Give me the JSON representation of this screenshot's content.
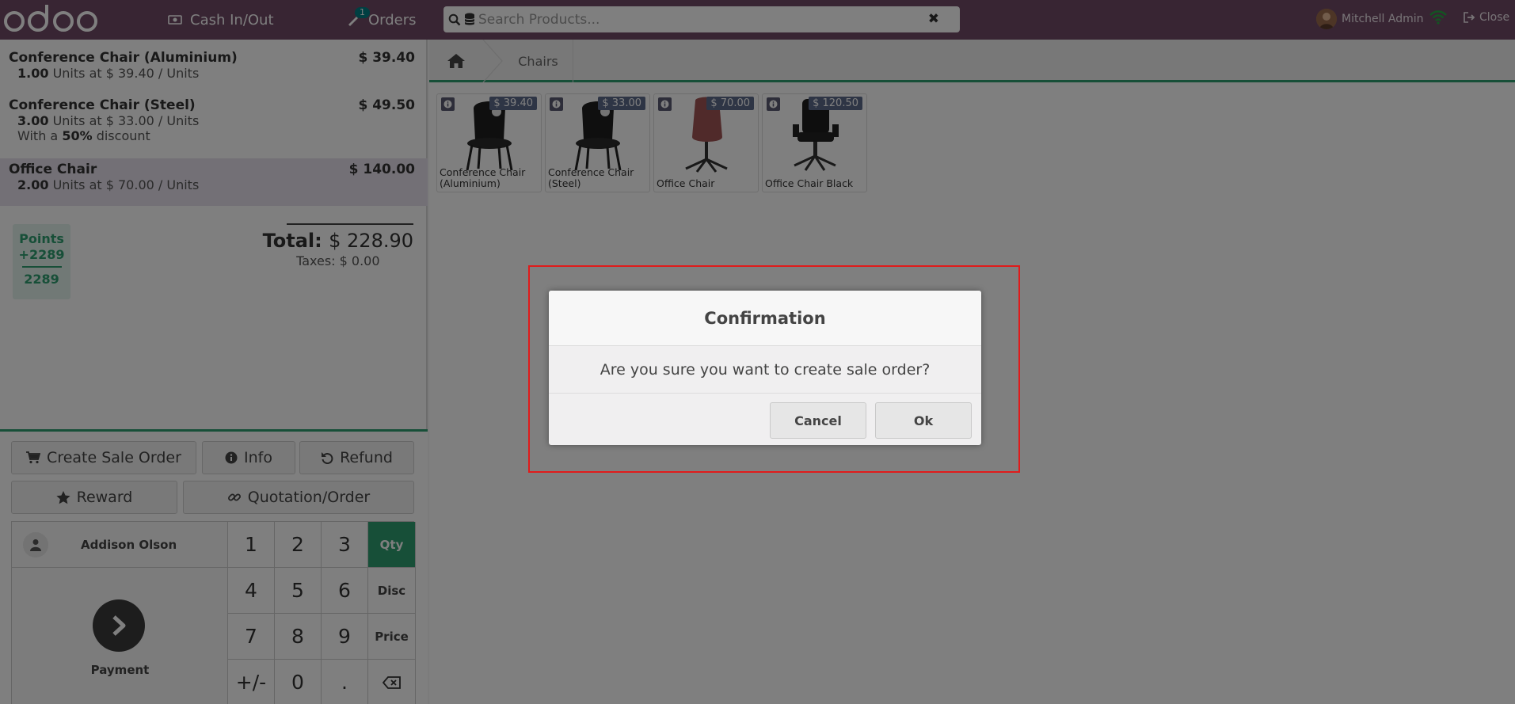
{
  "navbar": {
    "cash_label": "Cash In/Out",
    "orders_label": "Orders",
    "orders_count": "1",
    "search_placeholder": "Search Products...",
    "user_name": "Mitchell Admin",
    "close_label": "Close",
    "bg_color": "#714b67"
  },
  "order": {
    "lines": [
      {
        "name": "Conference Chair (Aluminium)",
        "price": "$ 39.40",
        "qty": "1.00",
        "unit_text": "Units at $ 39.40 / Units"
      },
      {
        "name": "Conference Chair (Steel)",
        "price": "$ 49.50",
        "qty": "3.00",
        "unit_text": "Units at $ 33.00 / Units",
        "discount_prefix": "With a",
        "discount": "50%",
        "discount_suffix": "discount"
      },
      {
        "name": "Office Chair",
        "price": "$ 140.00",
        "qty": "2.00",
        "unit_text": "Units at $ 70.00 / Units"
      }
    ],
    "points": {
      "label": "Points",
      "added": "+2289",
      "total": "2289"
    },
    "total_label": "Total:",
    "total_value": "$ 228.90",
    "taxes": "Taxes: $ 0.00"
  },
  "controls": {
    "create_sale_order": "Create Sale Order",
    "info": "Info",
    "refund": "Refund",
    "reward": "Reward",
    "quotation_order": "Quotation/Order",
    "customer": "Addison Olson",
    "payment": "Payment",
    "keys": {
      "k1": "1",
      "k2": "2",
      "k3": "3",
      "k4": "4",
      "k5": "5",
      "k6": "6",
      "k7": "7",
      "k8": "8",
      "k9": "9",
      "plusminus": "+/-",
      "k0": "0",
      "dot": "."
    },
    "modes": {
      "qty": "Qty",
      "disc": "Disc",
      "price": "Price"
    },
    "accent_color": "#2e9e70"
  },
  "products": {
    "breadcrumb": "Chairs",
    "items": [
      {
        "name1": "Conference Chair",
        "name2": "(Aluminium)",
        "price": "$ 39.40"
      },
      {
        "name1": "Conference Chair",
        "name2": "(Steel)",
        "price": "$ 33.00"
      },
      {
        "name1": "Office Chair",
        "name2": "",
        "price": "$ 70.00"
      },
      {
        "name1": "Office Chair Black",
        "name2": "",
        "price": "$ 120.50"
      }
    ]
  },
  "dialog": {
    "title": "Confirmation",
    "body": "Are you sure you want to create sale order?",
    "cancel": "Cancel",
    "ok": "Ok"
  }
}
